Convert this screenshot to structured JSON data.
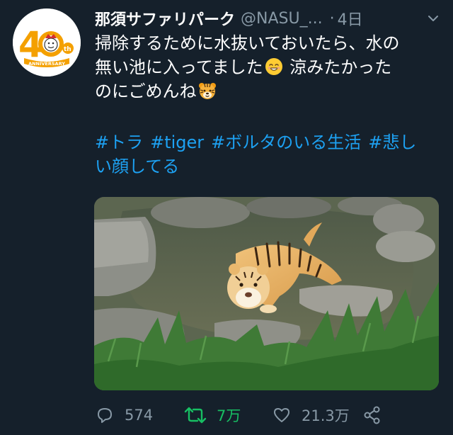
{
  "tweet": {
    "avatar_text": "40th",
    "avatar_banner": "ANNIVERSARY",
    "display_name": "那須サファリパーク",
    "handle": "@NASU_...",
    "separator": "·",
    "time": "4日",
    "text_line1": "掃除するために水抜いておいたら、水の",
    "text_line2_before_emoji": "無い池に入ってました",
    "text_line2_after_emoji": " 涼みたかった",
    "text_line3": "のにごめんね",
    "emoji_smile_name": "smiling-face-emoji",
    "emoji_tiger_name": "tiger-face-emoji",
    "hashtags": [
      "#トラ",
      "#tiger",
      "#ボルタのいる生活",
      "#悲し",
      "い顔してる"
    ]
  },
  "actions": {
    "reply_count": "574",
    "retweet_count": "7万",
    "like_count": "21.3万"
  },
  "colors": {
    "background": "#15202b",
    "secondary_text": "#8899a6",
    "link": "#1da1f2",
    "retweet_active": "#17bf63",
    "avatar_number": "#f4a000"
  }
}
